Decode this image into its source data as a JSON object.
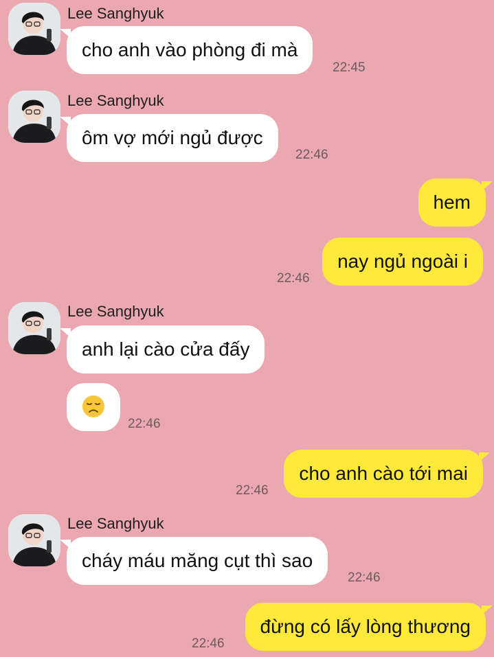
{
  "contact": {
    "name": "Lee Sanghyuk"
  },
  "messages": [
    {
      "from": "them",
      "text": "cho anh vào phòng đi mà",
      "time": "22:45"
    },
    {
      "from": "them",
      "text": "ôm vợ mới ngủ được",
      "time": "22:46"
    },
    {
      "from": "me",
      "text": "hem",
      "time": ""
    },
    {
      "from": "me",
      "text": "nay ngủ ngoài i",
      "time": "22:46"
    },
    {
      "from": "them",
      "text": "anh lại cào cửa đấy",
      "time": ""
    },
    {
      "from": "them",
      "emoji": "disappointed-face",
      "time": "22:46"
    },
    {
      "from": "me",
      "text": "cho anh cào tới mai",
      "time": "22:46"
    },
    {
      "from": "them",
      "text": "cháy máu măng cụt thì sao",
      "time": "22:46"
    },
    {
      "from": "me",
      "text": "đừng có lấy lòng thương",
      "time": "22:46"
    }
  ],
  "colors": {
    "background": "#eca8b1",
    "incoming": "#ffffff",
    "outgoing": "#fde93c"
  }
}
